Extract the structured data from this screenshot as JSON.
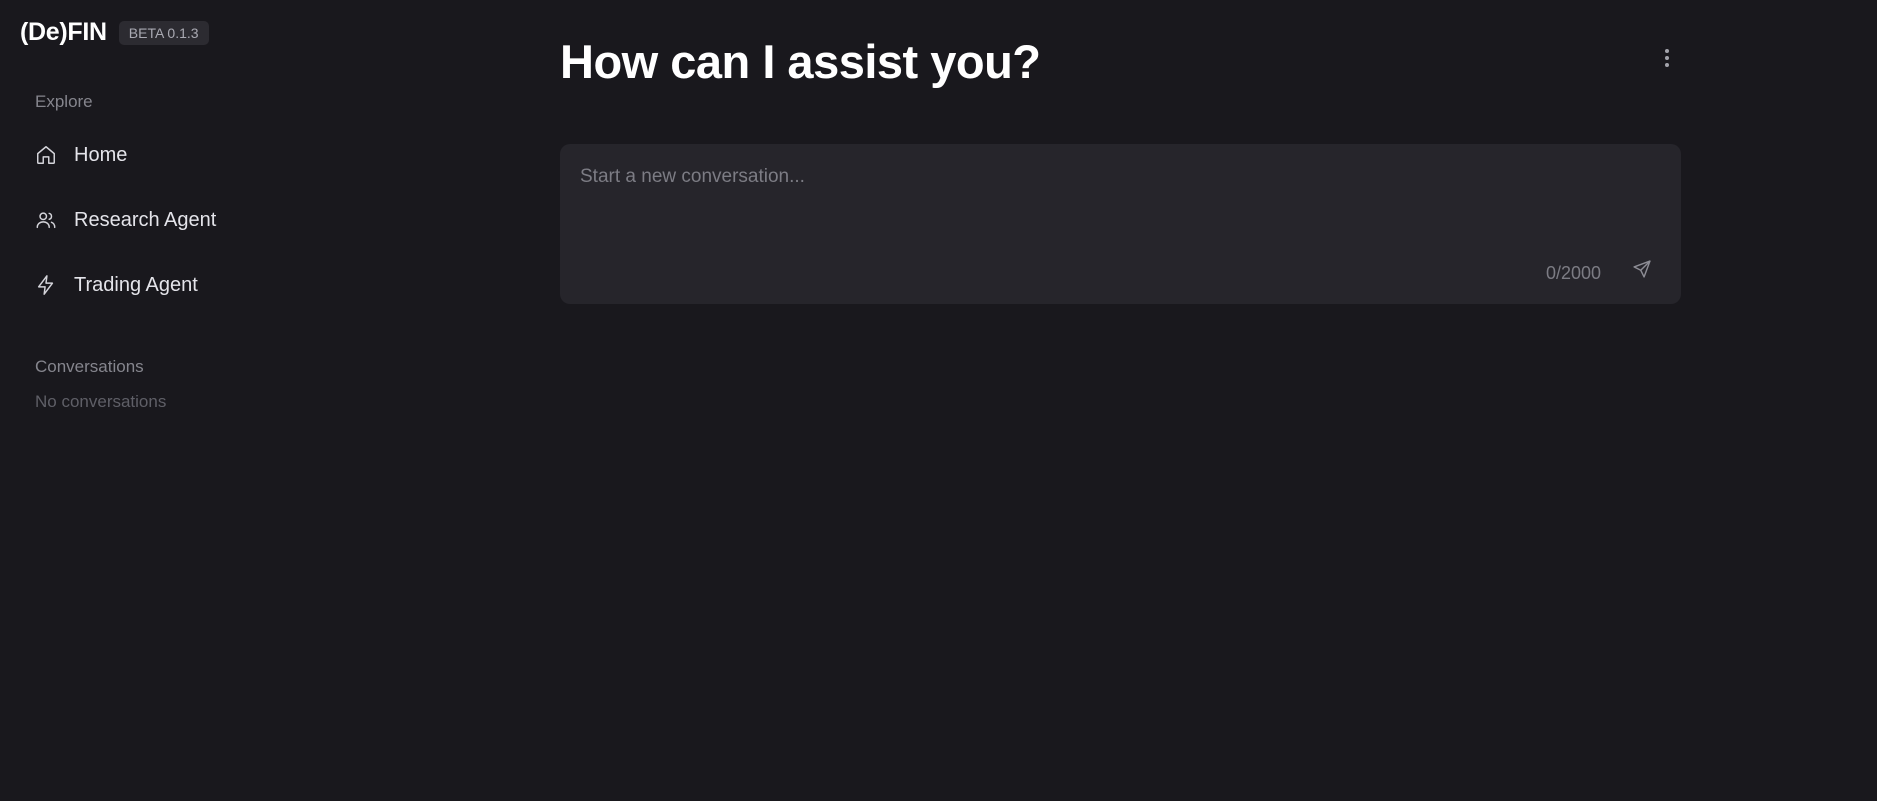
{
  "brand": {
    "logo": "(De)FIN",
    "version": "BETA 0.1.3"
  },
  "sidebar": {
    "explore_label": "Explore",
    "items": [
      {
        "label": "Home",
        "icon": "home-icon"
      },
      {
        "label": "Research Agent",
        "icon": "users-icon"
      },
      {
        "label": "Trading Agent",
        "icon": "lightning-icon"
      }
    ],
    "conversations_label": "Conversations",
    "conversations_empty": "No conversations"
  },
  "main": {
    "title": "How can I assist you?",
    "composer": {
      "placeholder": "Start a new conversation...",
      "value": "",
      "char_count": "0/2000"
    },
    "more_icon": "more-vertical-icon",
    "send_icon": "send-icon"
  },
  "colors": {
    "background": "#19181d",
    "composer_bg": "#26252b",
    "badge_bg": "#2c2b31",
    "text_primary": "#ffffff",
    "text_muted": "#85858d"
  }
}
